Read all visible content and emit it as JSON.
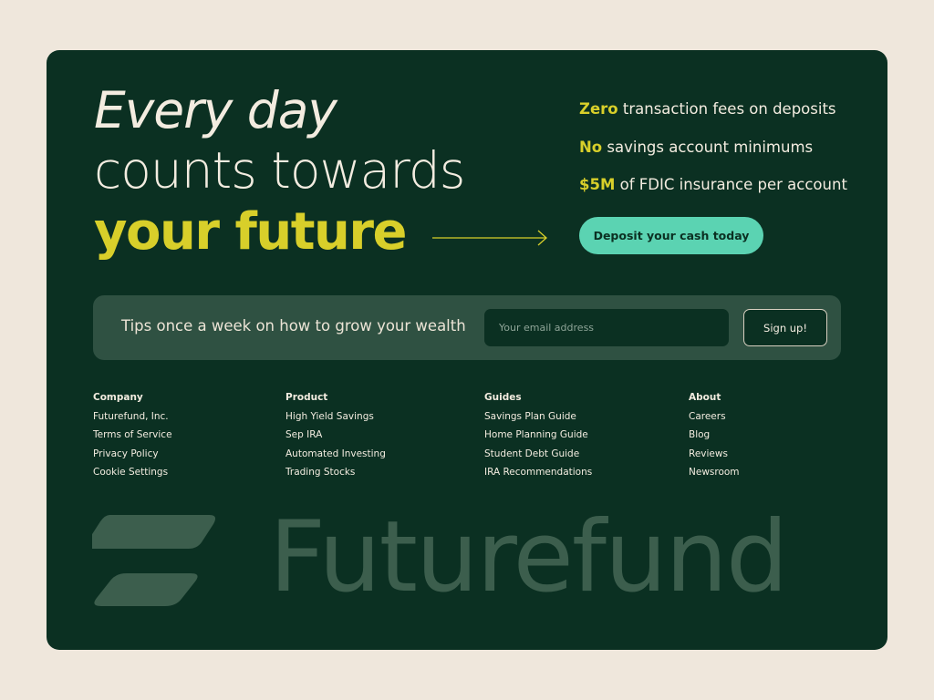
{
  "hero": {
    "line1": "Every day",
    "line2": "counts towards",
    "line3": "your future"
  },
  "features": [
    {
      "highlight": "Zero",
      "text": " transaction fees on deposits"
    },
    {
      "highlight": "No",
      "text": " savings account minimums"
    },
    {
      "highlight": "$5M",
      "text": " of FDIC insurance per account"
    }
  ],
  "cta": {
    "label": "Deposit your cash today"
  },
  "newsletter": {
    "text": "Tips once a week on how to grow your wealth",
    "placeholder": "Your email address",
    "button_label": "Sign up!"
  },
  "footer": {
    "columns": [
      {
        "title": "Company",
        "links": [
          "Futurefund, Inc.",
          "Terms of Service",
          "Privacy Policy",
          "Cookie Settings"
        ]
      },
      {
        "title": "Product",
        "links": [
          "High Yield Savings",
          "Sep IRA",
          "Automated Investing",
          "Trading Stocks"
        ]
      },
      {
        "title": "Guides",
        "links": [
          "Savings Plan Guide",
          "Home Planning Guide",
          "Student Debt Guide",
          "IRA Recommendations"
        ]
      },
      {
        "title": "About",
        "links": [
          "Careers",
          "Blog",
          "Reviews",
          "Newsroom"
        ]
      }
    ]
  },
  "brand": {
    "wordmark": "Futurefund",
    "logo_icon": "futurefund-logo-icon"
  },
  "colors": {
    "background": "#efe7dc",
    "card": "#0b3022",
    "accent_yellow": "#d8cf2a",
    "accent_teal": "#5bd3b2",
    "newsletter_bg": "#2f5142",
    "wordmark": "#3c5e4d"
  }
}
